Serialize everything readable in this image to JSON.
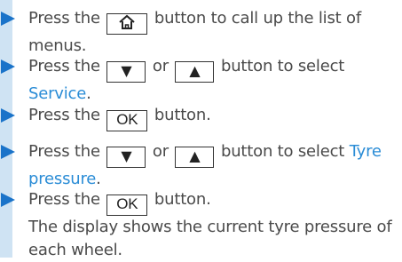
{
  "steps": [
    {
      "pre": "Press the",
      "button": "home-icon",
      "post": "button to call up the list of menus."
    },
    {
      "pre": "Press the",
      "b1": "▼",
      "mid": "or",
      "b2": "▲",
      "post": "button to select",
      "link": "Service",
      "end": "."
    },
    {
      "pre": "Press the",
      "ok": "OK",
      "post": "button."
    },
    {
      "pre": "Press the",
      "b1": "▼",
      "mid": "or",
      "b2": "▲",
      "post": "button to select",
      "link1": "Tyre",
      "link2": "pressure",
      "end": "."
    },
    {
      "pre": "Press the",
      "ok": "OK",
      "post": "button.",
      "line2": "The display shows the current tyre pressure of",
      "line3": "each wheel."
    }
  ],
  "colors": {
    "arrow": "#1a73c9",
    "link": "#2a8cd6",
    "sidebar": "#cfe3f3"
  }
}
